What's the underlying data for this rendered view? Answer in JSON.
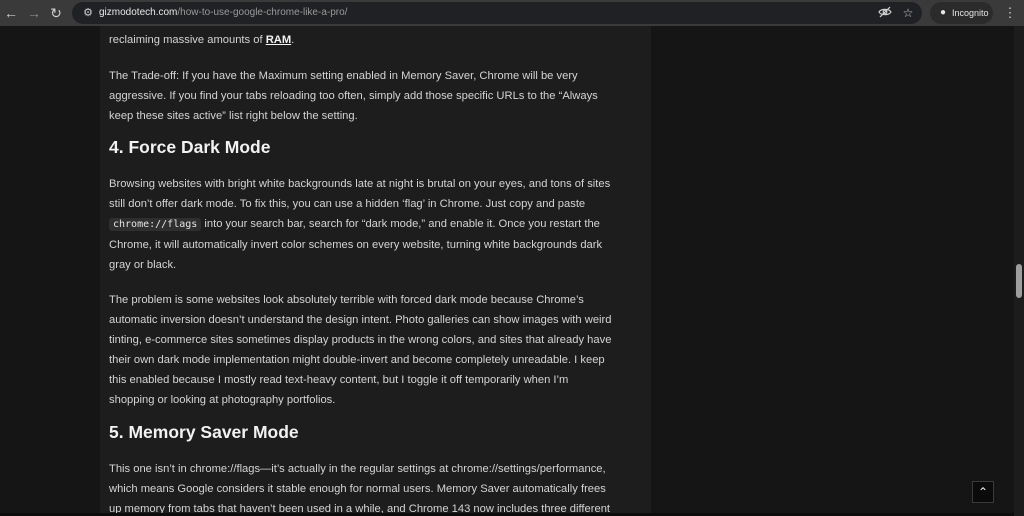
{
  "browser": {
    "back_icon": "arrow-left-icon",
    "forward_icon": "arrow-right-icon",
    "reload_icon": "reload-icon",
    "site_info_icon": "tune-icon",
    "url_host": "gizmodotech.com",
    "url_path": "/how-to-use-google-chrome-like-a-pro/",
    "incognito_label": "Incognito",
    "menu_icon": "more-vert-icon"
  },
  "article": {
    "p0_prefix": "reclaiming massive amounts of ",
    "p0_link": "RAM",
    "p0_suffix": ".",
    "p1_line1": "The Trade-off: If you have the Maximum setting enabled in Memory Saver, Chrome will be very",
    "p1_line2": "aggressive. If you find your tabs reloading too often, simply add those specific URLs to the “Always",
    "p1_line3": "keep these sites active” list right below the setting.",
    "h4": "4. Force Dark Mode",
    "p2_line1": "Browsing websites with bright white backgrounds late at night is brutal on your eyes, and tons of sites",
    "p2_line2": "still don’t offer dark mode. To fix this, you can use a hidden ‘flag’ in Chrome. Just copy and paste",
    "p2_code": "chrome://flags",
    "p2_line3_rest": " into your search bar, search for “dark mode,” and enable it. Once you restart the",
    "p2_line4": "Chrome, it will automatically invert color schemes on every website, turning white backgrounds dark",
    "p2_line5": "gray or black.",
    "p3_line1": "The problem is some websites look absolutely terrible with forced dark mode because Chrome’s",
    "p3_line2": "automatic inversion doesn’t understand the design intent. Photo galleries can show images with weird",
    "p3_line3": "tinting, e-commerce sites sometimes display products in the wrong colors, and sites that already have",
    "p3_line4": "their own dark mode implementation might double-invert and become completely unreadable. I keep",
    "p3_line5": "this enabled because I mostly read text-heavy content, but I toggle it off temporarily when I’m",
    "p3_line6": "shopping or looking at photography portfolios.",
    "h5": "5. Memory Saver Mode",
    "p4_line1": "This one isn’t in chrome://flags—it’s actually in the regular settings at chrome://settings/performance,",
    "p4_line2": "which means Google considers it stable enough for normal users. Memory Saver automatically frees",
    "p4_line3": "up memory from tabs that haven’t been used in a while, and Chrome 143 now includes three different"
  },
  "back_to_top_icon": "chevron-up-icon"
}
